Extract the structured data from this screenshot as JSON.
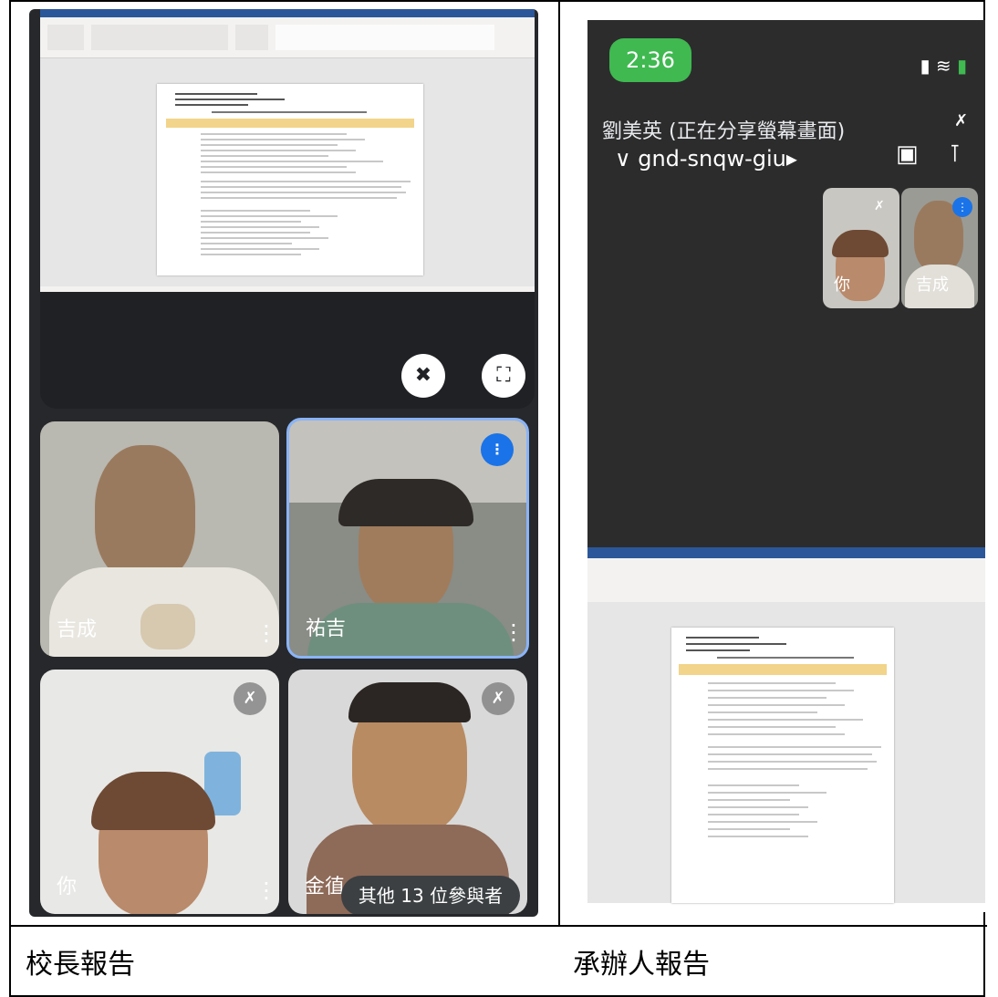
{
  "left": {
    "participants": [
      {
        "name": "吉成"
      },
      {
        "name": "祐吉"
      },
      {
        "name": "你"
      },
      {
        "name": "金徝"
      }
    ],
    "others_pill": "其他 13 位參與者",
    "controls": {
      "unpin_icon": "unpin-icon",
      "fullscreen_icon": "fullscreen-icon"
    }
  },
  "right": {
    "time": "2:36",
    "presenter": "劉美英 (正在分享螢幕畫面)",
    "meeting_code": "gnd-snqw-giu",
    "self_tiles": [
      {
        "name": "你"
      },
      {
        "name": "吉成"
      }
    ]
  },
  "captions": {
    "left": "校長報告",
    "right": "承辦人報告"
  },
  "colors": {
    "meet_dark": "#202124",
    "speaking_blue": "#1a73e8",
    "time_green": "#3fb950",
    "word_blue": "#2b579a"
  }
}
